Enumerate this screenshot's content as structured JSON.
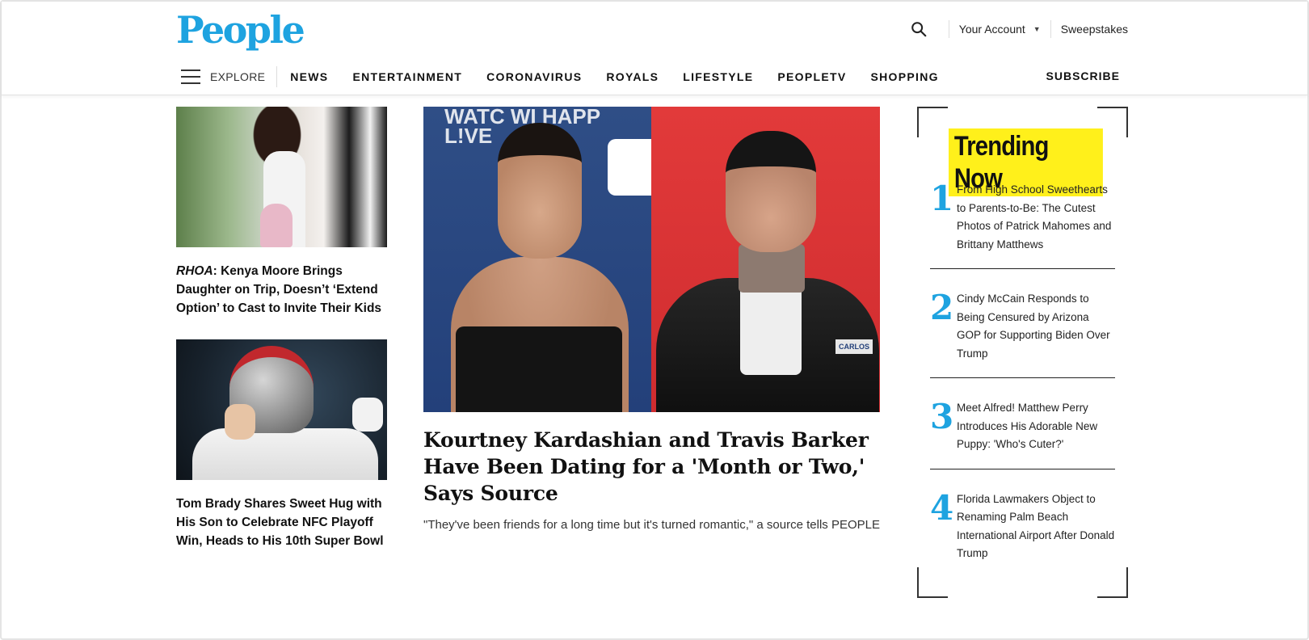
{
  "brand": {
    "logo": "People",
    "logo_color": "#1ea3e0"
  },
  "header": {
    "account_label": "Your Account",
    "sweepstakes_label": "Sweepstakes",
    "explore_label": "EXPLORE",
    "subscribe_label": "SUBSCRIBE",
    "nav": [
      {
        "label": "NEWS"
      },
      {
        "label": "ENTERTAINMENT"
      },
      {
        "label": "CORONAVIRUS"
      },
      {
        "label": "ROYALS"
      },
      {
        "label": "LIFESTYLE"
      },
      {
        "label": "PEOPLETV"
      },
      {
        "label": "SHOPPING"
      }
    ]
  },
  "left_stories": [
    {
      "title_em": "RHOA",
      "title_rest": ": Kenya Moore Brings Daughter on Trip, Doesn’t ‘Extend Option’ to Cast to Invite Their Kids"
    },
    {
      "title": "Tom Brady Shares Sweet Hug with His Son to Celebrate NFC Playoff Win, Heads to His 10th Super Bowl"
    }
  ],
  "feature": {
    "image_text": "WATC WI HAPP L!VE",
    "image_patch": "CARLOS",
    "title": "Kourtney Kardashian and Travis Barker Have Been Dating for a 'Month or Two,' Says Source",
    "dek": "\"They've been friends for a long time but it's turned romantic,\" a source tells PEOPLE"
  },
  "trending": {
    "heading": "Trending Now",
    "highlight_color": "#fff01b",
    "items": [
      {
        "num": "1",
        "text": "From High School Sweethearts to Parents-to-Be: The Cutest Photos of Patrick Mahomes and Brittany Matthews"
      },
      {
        "num": "2",
        "text": "Cindy McCain Responds to Being Censured by Arizona GOP for Supporting Biden Over Trump"
      },
      {
        "num": "3",
        "text": "Meet Alfred! Matthew Perry Introduces His Adorable New Puppy: 'Who's Cuter?'"
      },
      {
        "num": "4",
        "text": "Florida Lawmakers Object to Renaming Palm Beach International Airport After Donald Trump"
      }
    ]
  }
}
